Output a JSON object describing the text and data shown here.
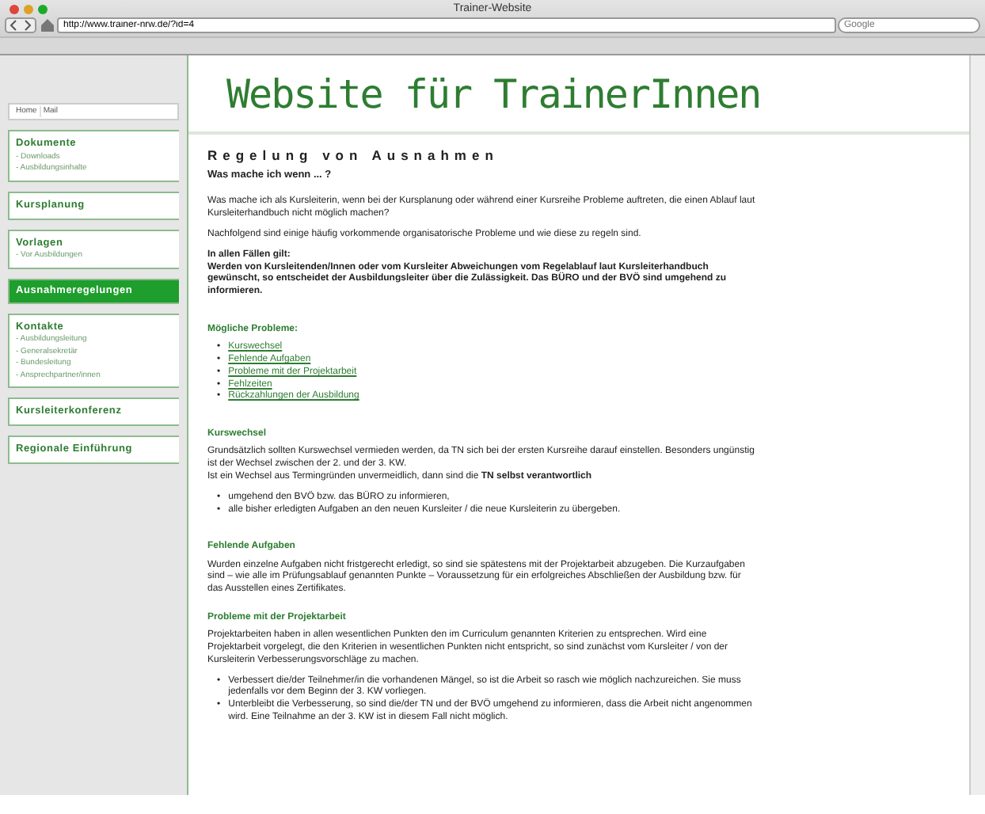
{
  "window": {
    "title": "Trainer-Website"
  },
  "address_bar": {
    "url": "http://www.trainer-nrw.de/?id=4"
  },
  "search": {
    "placeholder": "Google"
  },
  "site": {
    "title": "Website für TrainerInnen"
  },
  "breadcrumb": [
    "Home",
    "Mail"
  ],
  "sidebar": {
    "items": [
      {
        "label": "Dokumente",
        "selected": false,
        "children": [
          {
            "label": "- Downloads"
          },
          {
            "label": "- Ausbildungsinhalte"
          }
        ]
      },
      {
        "label": "Kursplanung",
        "selected": false
      },
      {
        "label": "Vorlagen",
        "selected": false,
        "children": [
          {
            "label": "- Vor Ausbildungen"
          }
        ]
      },
      {
        "label": "Ausnahmeregelungen",
        "selected": true
      },
      {
        "label": "Kontakte",
        "selected": false,
        "children": [
          {
            "label": "- Ausbildungsleitung"
          },
          {
            "label": "- Generalsekretär"
          },
          {
            "label": "- Bundesleitung"
          },
          {
            "label": "- Ansprechpartner/innen"
          }
        ]
      },
      {
        "label": "Kursleiterkonferenz",
        "selected": false
      },
      {
        "label": "Regionale Einführung",
        "selected": false
      }
    ]
  },
  "content": {
    "title": "Regelung von Ausnahmen",
    "subtitle": "Was mache ich wenn ... ?",
    "blocks": [
      {
        "kind": "para",
        "text": "Was mache ich als Kursleiterin, wenn bei der Kursplanung oder während einer Kursreihe Probleme auftreten, die einen Ablauf laut Kursleiterhandbuch nicht möglich machen?"
      },
      {
        "kind": "para",
        "text": "Nachfolgend sind einige häufig vorkommende organisatorische Probleme und wie diese zu regeln sind."
      },
      {
        "kind": "bold",
        "text": "In allen Fällen gilt:\nWerden von Kursleitenden/Innen oder vom Kursleiter Abweichungen vom Regelablauf laut Kursleiterhandbuch gewünscht, so entscheidet der Ausbildungsleiter über die Zulässigkeit. Das BÜRO und der BVÖ sind umgehend zu informieren."
      },
      {
        "kind": "heading",
        "text": "Mögliche Probleme:"
      },
      {
        "kind": "links",
        "marker": "•",
        "items": [
          "Kurswechsel",
          "Fehlende Aufgaben",
          "Probleme mit der Projektarbeit",
          "Fehlzeiten",
          "Rückzahlungen der Ausbildung"
        ]
      },
      {
        "kind": "heading",
        "text": "Kurswechsel"
      },
      {
        "kind": "para",
        "text": "Grundsätzlich sollten Kurswechsel vermieden werden, da TN sich bei der ersten Kursreihe darauf einstellen. Besonders ungünstig ist der Wechsel zwischen der 2. und der 3. KW.\nIst ein Wechsel aus Termingründen unvermeidlich, dann sind die **TN selbst verantwortlich**"
      },
      {
        "kind": "list",
        "marker": "•",
        "items": [
          "umgehend den BVÖ bzw. das BÜRO zu informieren,",
          "alle bisher erledigten Aufgaben an den neuen Kursleiter / die neue Kursleiterin zu übergeben."
        ]
      },
      {
        "kind": "heading",
        "text": "Fehlende Aufgaben"
      },
      {
        "kind": "para",
        "text": "Wurden einzelne Aufgaben nicht fristgerecht erledigt, so sind sie spätestens mit der Projektarbeit abzugeben. Die Kurzaufgaben sind – wie alle im Prüfungsablauf genannten Punkte – Voraussetzung für ein erfolgreiches Abschließen der Ausbildung bzw. für das Ausstellen eines Zertifikates."
      },
      {
        "kind": "heading",
        "text": "Probleme mit der Projektarbeit"
      },
      {
        "kind": "para",
        "text": "Projektarbeiten haben in allen wesentlichen Punkten den im Curriculum genannten Kriterien zu entsprechen. Wird eine Projektarbeit vorgelegt, die den Kriterien in wesentlichen Punkten nicht entspricht, so sind zunächst vom Kursleiter / von der Kursleiterin Verbesserungsvorschläge zu machen."
      },
      {
        "kind": "list",
        "marker": "•",
        "items": [
          "Verbessert die/der Teilnehmer/in die vorhandenen Mängel, so ist die Arbeit so rasch wie möglich nachzureichen. Sie muss jedenfalls vor dem Beginn der 3. KW vorliegen.",
          "Unterbleibt die Verbesserung, so sind die/der TN und der BVÖ umgehend zu informieren, dass die Arbeit nicht angenommen wird. Eine Teilnahme an der 3. KW ist in diesem Fall nicht möglich."
        ]
      }
    ]
  }
}
